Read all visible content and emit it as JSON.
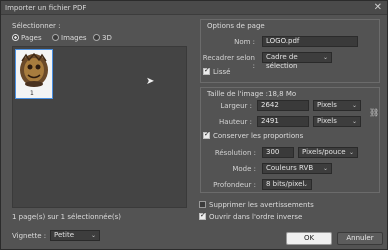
{
  "window": {
    "title": "Importer un fichier PDF",
    "close_glyph": "✕"
  },
  "left": {
    "select_label": "Sélectionner :",
    "radios": [
      {
        "label": "Pages",
        "checked": true
      },
      {
        "label": "Images",
        "checked": false
      },
      {
        "label": "3D",
        "checked": false
      }
    ],
    "thumbnail_number": "1",
    "selection_status": "1 page(s) sur 1 sélectionnée(s)",
    "vignette_label": "Vignette :",
    "vignette_value": "Petite"
  },
  "page_options": {
    "heading": "Options de page",
    "name_label": "Nom :",
    "name_value": "LOGO.pdf",
    "crop_label": "Recadrer selon :",
    "crop_value": "Cadre de sélection",
    "smooth_label": "Lissé",
    "smooth_checked": true
  },
  "image_size": {
    "heading": "Taille de l'image :18,8 Mo",
    "width_label": "Largeur :",
    "width_value": "2642",
    "width_unit": "Pixels",
    "height_label": "Hauteur :",
    "height_value": "2491",
    "height_unit": "Pixels",
    "constrain_label": "Conserver les proportions",
    "constrain_checked": true,
    "resolution_label": "Résolution :",
    "resolution_value": "300",
    "resolution_unit": "Pixels/pouce",
    "mode_label": "Mode :",
    "mode_value": "Couleurs RVB",
    "depth_label": "Profondeur :",
    "depth_value": "8 bits/pixel"
  },
  "options": {
    "suppress_warnings_label": "Supprimer les avertissements",
    "suppress_warnings_checked": false,
    "open_reverse_label": "Ouvrir dans l'ordre inverse",
    "open_reverse_checked": true
  },
  "buttons": {
    "ok": "OK",
    "cancel": "Annuler"
  },
  "colors": {
    "dialog_bg": "#535353",
    "accent": "#4a90e2",
    "field_bg": "#3a3a3a"
  }
}
